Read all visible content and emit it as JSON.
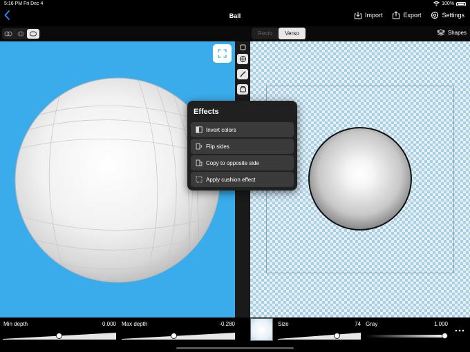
{
  "status_bar": {
    "time": "5:16 PM",
    "date": "Fri Dec 4",
    "battery": "100%"
  },
  "nav": {
    "title": "Ball",
    "import_label": "Import",
    "export_label": "Export",
    "settings_label": "Settings"
  },
  "toolbar": {
    "side_tabs": [
      "Recto",
      "Verso"
    ],
    "active_side": "Verso",
    "shapes_label": "Shapes"
  },
  "effects": {
    "title": "Effects",
    "items": [
      {
        "label": "Invert colors"
      },
      {
        "label": "Flip sides"
      },
      {
        "label": "Copy to opposite side"
      },
      {
        "label": "Apply cushion effect"
      }
    ]
  },
  "sliders": {
    "min_depth": {
      "label": "Min depth",
      "value": "0.000",
      "fraction": 0.5
    },
    "max_depth": {
      "label": "Max depth",
      "value": "-0.280",
      "fraction": 0.47
    },
    "size": {
      "label": "Size",
      "value": "74",
      "fraction": 0.74
    },
    "gray": {
      "label": "Gray",
      "value": "1.000",
      "fraction": 1.0
    }
  },
  "colors": {
    "accent": "#1e90ff",
    "view_background": "#3aaceb"
  }
}
